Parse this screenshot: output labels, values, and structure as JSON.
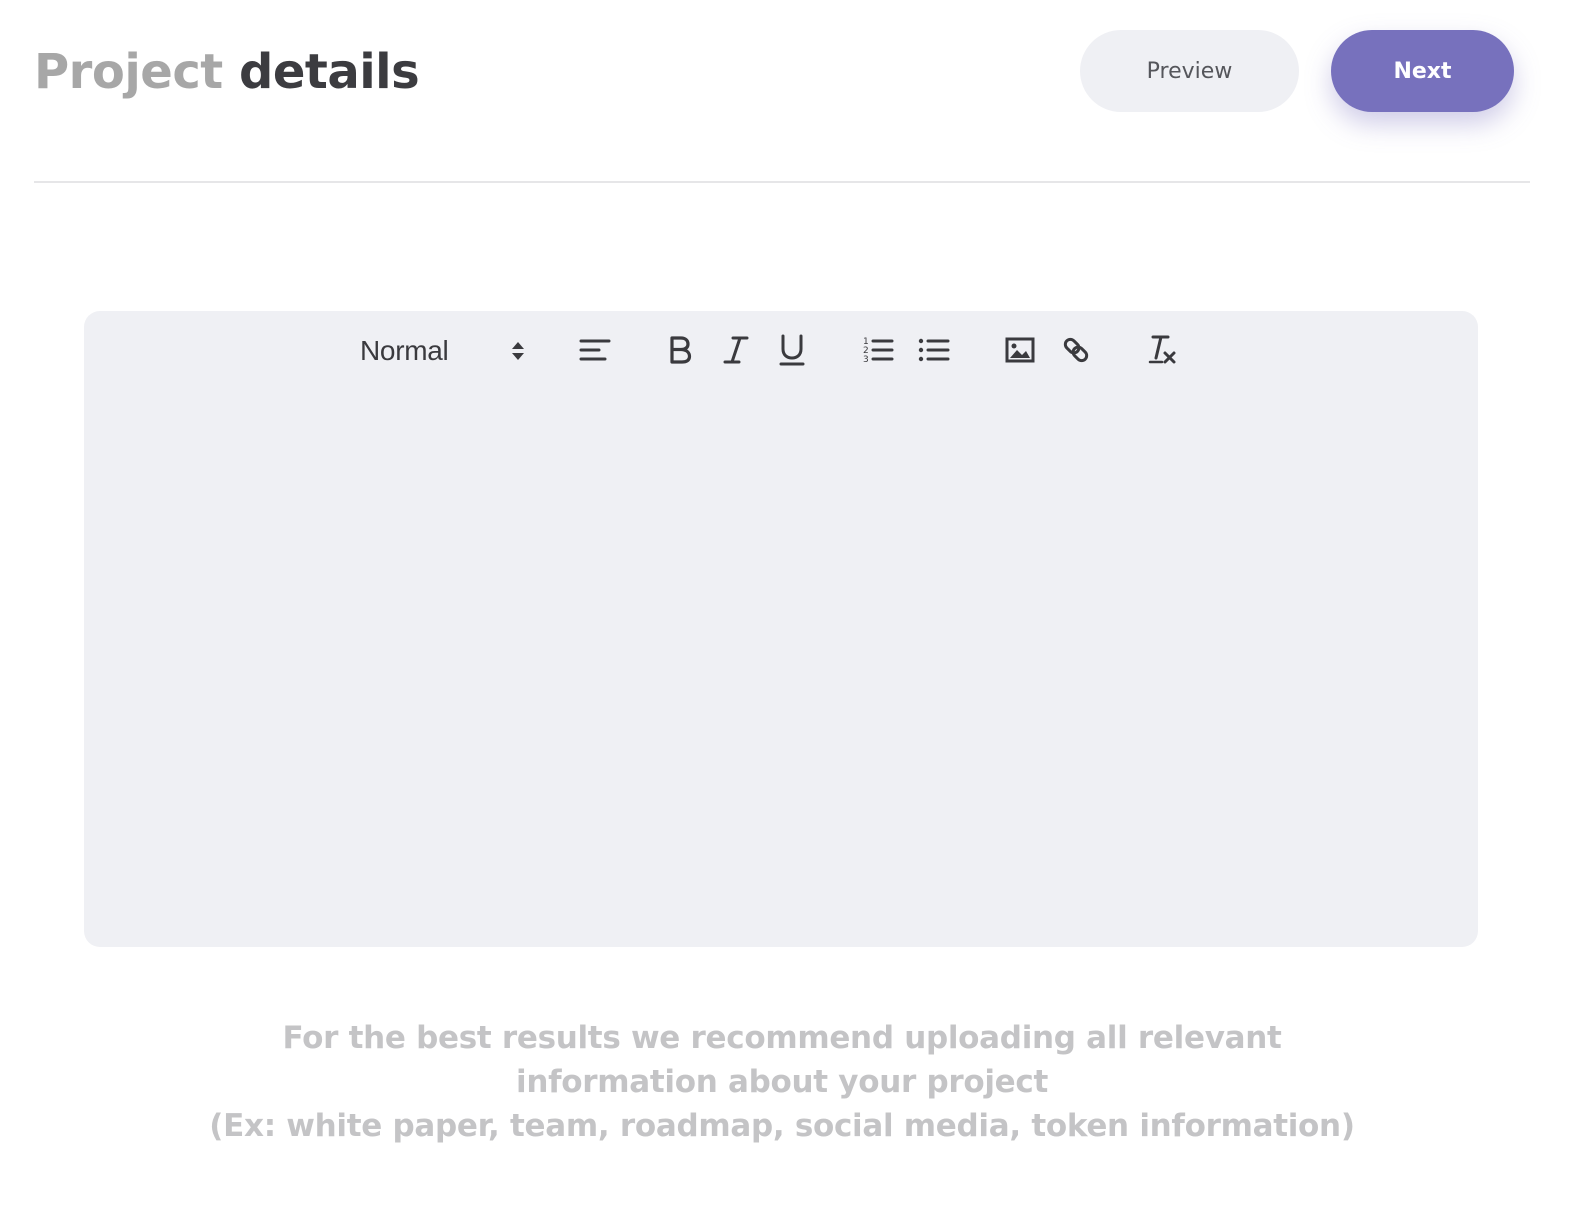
{
  "header": {
    "title_muted": "Project",
    "title_strong": "details",
    "preview_label": "Preview",
    "next_label": "Next"
  },
  "editor": {
    "format_value": "Normal",
    "toolbar_icons": [
      "chevron-updown-icon",
      "align-left-icon",
      "bold-icon",
      "italic-icon",
      "underline-icon",
      "ordered-list-icon",
      "bullet-list-icon",
      "image-icon",
      "link-icon",
      "clear-format-icon"
    ],
    "content": ""
  },
  "hint": {
    "line1": "For the best results we recommend uploading all relevant",
    "line2": "information about your project",
    "line3": "(Ex: white paper, team, roadmap, social media, token information)"
  },
  "colors": {
    "accent": "#7771bd",
    "editor_bg": "#eff0f4",
    "title_muted": "#a7a7a7",
    "title_strong": "#3c3c40",
    "hint_text": "#c4c4c6"
  }
}
